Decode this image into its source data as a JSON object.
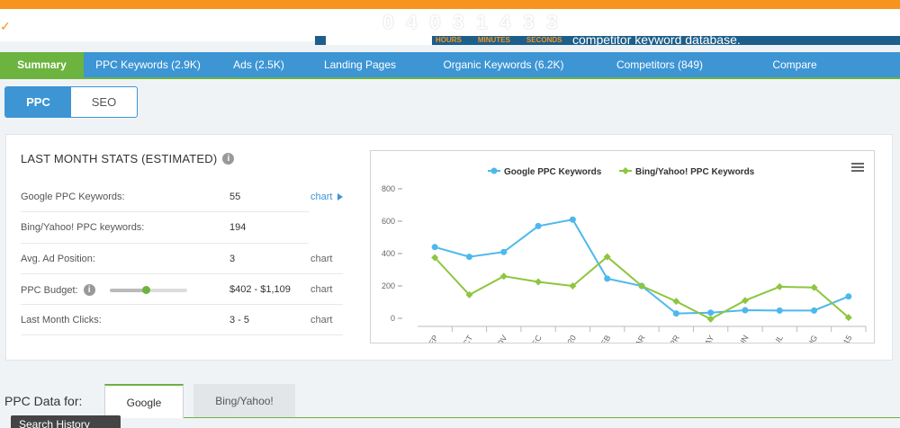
{
  "banner": {
    "countdown_digits": [
      "0",
      "4",
      "0",
      "3",
      "1",
      "4",
      "3",
      "3"
    ],
    "timer_labels": [
      "HOURS",
      "MINUTES",
      "SECONDS"
    ],
    "promo_text": "competitor keyword database."
  },
  "nav": {
    "items": [
      {
        "label": "Summary",
        "active": true
      },
      {
        "label": "PPC Keywords (2.9K)"
      },
      {
        "label": "Ads (2.5K)"
      },
      {
        "label": "Landing Pages"
      },
      {
        "label": "Organic Keywords (6.2K)"
      },
      {
        "label": "Competitors (849)"
      },
      {
        "label": "Compare"
      }
    ]
  },
  "toggle": {
    "ppc": "PPC",
    "seo": "SEO"
  },
  "stats": {
    "title": "LAST MONTH STATS (ESTIMATED)",
    "rows": [
      {
        "label": "Google PPC Keywords:",
        "value": "55",
        "link": "chart"
      },
      {
        "label": "Bing/Yahoo! PPC keywords:",
        "value": "194",
        "link": ""
      },
      {
        "label": "Avg. Ad Position:",
        "value": "3",
        "link": "chart"
      },
      {
        "label": "PPC Budget:",
        "value": "$402 - $1,109",
        "link": "chart"
      },
      {
        "label": "Last Month Clicks:",
        "value": "3 - 5",
        "link": "chart"
      }
    ],
    "budget_slider_level": 0.47
  },
  "colors": {
    "accent_blue": "#3d95d4",
    "accent_green": "#6cb33f",
    "banner_orange": "#f7941e"
  },
  "chart_data": {
    "type": "line",
    "categories": [
      "SEP",
      "OCT",
      "NOV",
      "DEC",
      "JAN 2020",
      "FEB",
      "MAR",
      "APR",
      "MAY",
      "JUN",
      "JUL",
      "AUG",
      "SEP 1-15"
    ],
    "series": [
      {
        "name": "Google PPC Keywords",
        "color": "#4db8ec",
        "values": [
          440,
          380,
          410,
          570,
          610,
          245,
          200,
          30,
          35,
          50,
          48,
          48,
          135
        ]
      },
      {
        "name": "Bing/Yahoo! PPC Keywords",
        "color": "#8dc63f",
        "values": [
          375,
          145,
          260,
          225,
          200,
          380,
          200,
          105,
          -5,
          110,
          195,
          190,
          5
        ]
      }
    ],
    "yticks": [
      0,
      200,
      400,
      600,
      800
    ],
    "ylim": [
      -50,
      850
    ],
    "legend_position": "top-center",
    "grid": false
  },
  "bottom": {
    "ppc_data_label": "PPC Data for:",
    "tabs": [
      {
        "label": "Google",
        "active": true
      },
      {
        "label": "Bing/Yahoo!"
      }
    ],
    "search_history": "Search History"
  }
}
